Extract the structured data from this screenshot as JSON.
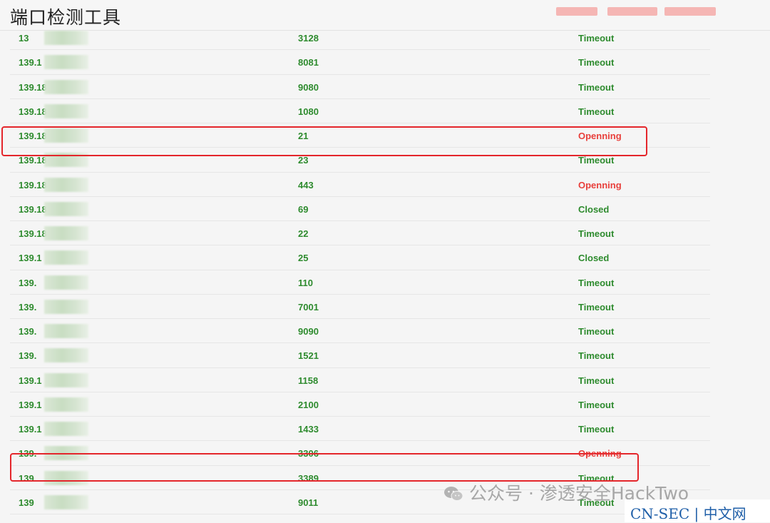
{
  "header": {
    "title": "端口检测工具"
  },
  "rows": [
    {
      "ip": "13",
      "port": "3128",
      "status": "Timeout",
      "open": false
    },
    {
      "ip": "139.1",
      "port": "8081",
      "status": "Timeout",
      "open": false
    },
    {
      "ip": "139.18",
      "port": "9080",
      "status": "Timeout",
      "open": false
    },
    {
      "ip": "139.18",
      "port": "1080",
      "status": "Timeout",
      "open": false
    },
    {
      "ip": "139.18",
      "port": "21",
      "status": "Openning",
      "open": true
    },
    {
      "ip": "139.18",
      "port": "23",
      "status": "Timeout",
      "open": false
    },
    {
      "ip": "139.18",
      "port": "443",
      "status": "Openning",
      "open": true
    },
    {
      "ip": "139.18",
      "port": "69",
      "status": "Closed",
      "open": false
    },
    {
      "ip": "139.18",
      "port": "22",
      "status": "Timeout",
      "open": false
    },
    {
      "ip": "139.1",
      "port": "25",
      "status": "Closed",
      "open": false
    },
    {
      "ip": "139.",
      "port": "110",
      "status": "Timeout",
      "open": false
    },
    {
      "ip": "139.",
      "port": "7001",
      "status": "Timeout",
      "open": false
    },
    {
      "ip": "139.",
      "port": "9090",
      "status": "Timeout",
      "open": false
    },
    {
      "ip": "139.",
      "port": "1521",
      "status": "Timeout",
      "open": false
    },
    {
      "ip": "139.1",
      "port": "1158",
      "status": "Timeout",
      "open": false
    },
    {
      "ip": "139.1",
      "port": "2100",
      "status": "Timeout",
      "open": false
    },
    {
      "ip": "139.1",
      "port": "1433",
      "status": "Timeout",
      "open": false
    },
    {
      "ip": "139.",
      "port": "3306",
      "status": "Openning",
      "open": true
    },
    {
      "ip": "139",
      "port": "3389",
      "status": "Timeout",
      "open": false
    },
    {
      "ip": "139",
      "port": "9011",
      "status": "Timeout",
      "open": false
    }
  ],
  "watermark": {
    "text": "公众号 · 渗透安全HackTwo"
  },
  "corner_badge": {
    "text": "CN-SEC | 中文网"
  },
  "colors": {
    "ok": "#2e8b2e",
    "open": "#e8403c",
    "highlight": "#e4262b"
  }
}
